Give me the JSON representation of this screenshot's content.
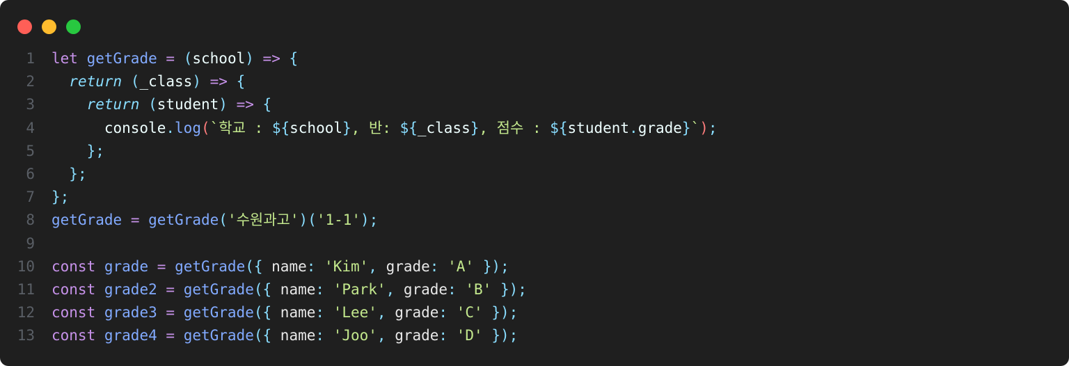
{
  "window": {
    "buttons": [
      {
        "name": "close",
        "color": "#ff5f57"
      },
      {
        "name": "minimize",
        "color": "#febc2e"
      },
      {
        "name": "zoom",
        "color": "#28c840"
      }
    ]
  },
  "code": {
    "lines": [
      {
        "n": "1",
        "tokens": [
          [
            "keyword",
            "let"
          ],
          [
            "plain",
            " "
          ],
          [
            "fn",
            "getGrade"
          ],
          [
            "plain",
            " "
          ],
          [
            "op",
            "="
          ],
          [
            "plain",
            " "
          ],
          [
            "punc",
            "("
          ],
          [
            "var",
            "school"
          ],
          [
            "punc",
            ")"
          ],
          [
            "plain",
            " "
          ],
          [
            "op",
            "=>"
          ],
          [
            "plain",
            " "
          ],
          [
            "punc",
            "{"
          ]
        ]
      },
      {
        "n": "2",
        "tokens": [
          [
            "plain",
            "  "
          ],
          [
            "italic",
            "return"
          ],
          [
            "plain",
            " "
          ],
          [
            "punc",
            "("
          ],
          [
            "var",
            "_class"
          ],
          [
            "punc",
            ")"
          ],
          [
            "plain",
            " "
          ],
          [
            "op",
            "=>"
          ],
          [
            "plain",
            " "
          ],
          [
            "punc",
            "{"
          ]
        ]
      },
      {
        "n": "3",
        "tokens": [
          [
            "plain",
            "    "
          ],
          [
            "italic",
            "return"
          ],
          [
            "plain",
            " "
          ],
          [
            "punc",
            "("
          ],
          [
            "var",
            "student"
          ],
          [
            "punc",
            ")"
          ],
          [
            "plain",
            " "
          ],
          [
            "op",
            "=>"
          ],
          [
            "plain",
            " "
          ],
          [
            "punc",
            "{"
          ]
        ]
      },
      {
        "n": "4",
        "tokens": [
          [
            "plain",
            "      "
          ],
          [
            "var",
            "console"
          ],
          [
            "punc",
            "."
          ],
          [
            "fn",
            "log"
          ],
          [
            "tpl",
            "("
          ],
          [
            "str",
            "`학교 : "
          ],
          [
            "punc",
            "${"
          ],
          [
            "var",
            "school"
          ],
          [
            "punc",
            "}"
          ],
          [
            "str",
            ", 반: "
          ],
          [
            "punc",
            "${"
          ],
          [
            "var",
            "_class"
          ],
          [
            "punc",
            "}"
          ],
          [
            "str",
            ", 점수 : "
          ],
          [
            "punc",
            "${"
          ],
          [
            "var",
            "student"
          ],
          [
            "punc",
            "."
          ],
          [
            "var",
            "grade"
          ],
          [
            "punc",
            "}"
          ],
          [
            "str",
            "`"
          ],
          [
            "tpl",
            ")"
          ],
          [
            "punc",
            ";"
          ]
        ]
      },
      {
        "n": "5",
        "tokens": [
          [
            "plain",
            "    "
          ],
          [
            "punc",
            "};"
          ]
        ]
      },
      {
        "n": "6",
        "tokens": [
          [
            "plain",
            "  "
          ],
          [
            "punc",
            "};"
          ]
        ]
      },
      {
        "n": "7",
        "tokens": [
          [
            "punc",
            "};"
          ]
        ]
      },
      {
        "n": "8",
        "tokens": [
          [
            "fn",
            "getGrade"
          ],
          [
            "plain",
            " "
          ],
          [
            "op",
            "="
          ],
          [
            "plain",
            " "
          ],
          [
            "fn",
            "getGrade"
          ],
          [
            "punc",
            "("
          ],
          [
            "str",
            "'수원과고'"
          ],
          [
            "punc",
            ")("
          ],
          [
            "str",
            "'1-1'"
          ],
          [
            "punc",
            ");"
          ]
        ]
      },
      {
        "n": "9",
        "tokens": []
      },
      {
        "n": "10",
        "tokens": [
          [
            "keyword",
            "const"
          ],
          [
            "plain",
            " "
          ],
          [
            "fn",
            "grade"
          ],
          [
            "plain",
            " "
          ],
          [
            "op",
            "="
          ],
          [
            "plain",
            " "
          ],
          [
            "fn",
            "getGrade"
          ],
          [
            "punc",
            "({"
          ],
          [
            "plain",
            " name"
          ],
          [
            "punc",
            ":"
          ],
          [
            "plain",
            " "
          ],
          [
            "str",
            "'Kim'"
          ],
          [
            "punc",
            ","
          ],
          [
            "plain",
            " grade"
          ],
          [
            "punc",
            ":"
          ],
          [
            "plain",
            " "
          ],
          [
            "str",
            "'A'"
          ],
          [
            "plain",
            " "
          ],
          [
            "punc",
            "});"
          ]
        ]
      },
      {
        "n": "11",
        "tokens": [
          [
            "keyword",
            "const"
          ],
          [
            "plain",
            " "
          ],
          [
            "fn",
            "grade2"
          ],
          [
            "plain",
            " "
          ],
          [
            "op",
            "="
          ],
          [
            "plain",
            " "
          ],
          [
            "fn",
            "getGrade"
          ],
          [
            "punc",
            "({"
          ],
          [
            "plain",
            " name"
          ],
          [
            "punc",
            ":"
          ],
          [
            "plain",
            " "
          ],
          [
            "str",
            "'Park'"
          ],
          [
            "punc",
            ","
          ],
          [
            "plain",
            " grade"
          ],
          [
            "punc",
            ":"
          ],
          [
            "plain",
            " "
          ],
          [
            "str",
            "'B'"
          ],
          [
            "plain",
            " "
          ],
          [
            "punc",
            "});"
          ]
        ]
      },
      {
        "n": "12",
        "tokens": [
          [
            "keyword",
            "const"
          ],
          [
            "plain",
            " "
          ],
          [
            "fn",
            "grade3"
          ],
          [
            "plain",
            " "
          ],
          [
            "op",
            "="
          ],
          [
            "plain",
            " "
          ],
          [
            "fn",
            "getGrade"
          ],
          [
            "punc",
            "({"
          ],
          [
            "plain",
            " name"
          ],
          [
            "punc",
            ":"
          ],
          [
            "plain",
            " "
          ],
          [
            "str",
            "'Lee'"
          ],
          [
            "punc",
            ","
          ],
          [
            "plain",
            " grade"
          ],
          [
            "punc",
            ":"
          ],
          [
            "plain",
            " "
          ],
          [
            "str",
            "'C'"
          ],
          [
            "plain",
            " "
          ],
          [
            "punc",
            "});"
          ]
        ]
      },
      {
        "n": "13",
        "tokens": [
          [
            "keyword",
            "const"
          ],
          [
            "plain",
            " "
          ],
          [
            "fn",
            "grade4"
          ],
          [
            "plain",
            " "
          ],
          [
            "op",
            "="
          ],
          [
            "plain",
            " "
          ],
          [
            "fn",
            "getGrade"
          ],
          [
            "punc",
            "({"
          ],
          [
            "plain",
            " name"
          ],
          [
            "punc",
            ":"
          ],
          [
            "plain",
            " "
          ],
          [
            "str",
            "'Joo'"
          ],
          [
            "punc",
            ","
          ],
          [
            "plain",
            " grade"
          ],
          [
            "punc",
            ":"
          ],
          [
            "plain",
            " "
          ],
          [
            "str",
            "'D'"
          ],
          [
            "plain",
            " "
          ],
          [
            "punc",
            "});"
          ]
        ]
      }
    ]
  }
}
